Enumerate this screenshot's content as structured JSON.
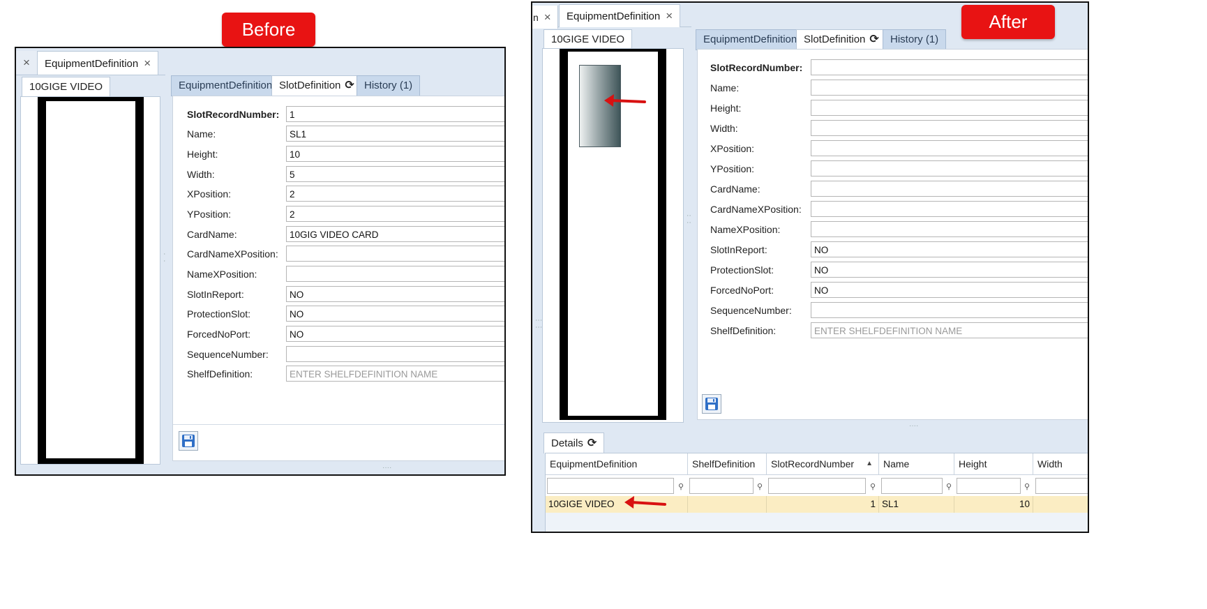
{
  "labels": {
    "before": "Before",
    "after": "After"
  },
  "tabs": {
    "doc_tab": "EquipmentDefinition",
    "close_glyph": "×",
    "stub_text": "n"
  },
  "left_panel": {
    "tab": "10GIGE VIDEO"
  },
  "form_tabs": {
    "equipment": "EquipmentDefinition",
    "slot": "SlotDefinition",
    "history": "History (1)",
    "refresh_glyph": "⟳"
  },
  "fields": {
    "labels": [
      "SlotRecordNumber:",
      "Name:",
      "Height:",
      "Width:",
      "XPosition:",
      "YPosition:",
      "CardName:",
      "CardNameXPosition:",
      "NameXPosition:",
      "SlotInReport:",
      "ProtectionSlot:",
      "ForcedNoPort:",
      "SequenceNumber:",
      "ShelfDefinition:"
    ],
    "before_values": [
      "1",
      "SL1",
      "10",
      "5",
      "2",
      "2",
      "10GIG VIDEO CARD",
      "",
      "",
      "NO",
      "NO",
      "NO",
      "",
      ""
    ],
    "after_values": [
      "",
      "",
      "",
      "",
      "",
      "",
      "",
      "",
      "",
      "NO",
      "NO",
      "NO",
      "",
      ""
    ],
    "shelf_placeholder": "ENTER SHELFDEFINITION NAME"
  },
  "details": {
    "tab": "Details",
    "columns": [
      "EquipmentDefinition",
      "ShelfDefinition",
      "SlotRecordNumber",
      "Name",
      "Height",
      "Width"
    ],
    "sort_glyph": "▲",
    "filter_glyph": "⚲",
    "rows": [
      {
        "equipment": "10GIGE VIDEO",
        "shelf": "",
        "slot": "1",
        "name": "SL1",
        "height": "10",
        "width": ""
      }
    ]
  },
  "colors": {
    "badge": "#e81313",
    "selected_row": "#fbedc3",
    "inactive_tab": "#c9d9ec"
  }
}
